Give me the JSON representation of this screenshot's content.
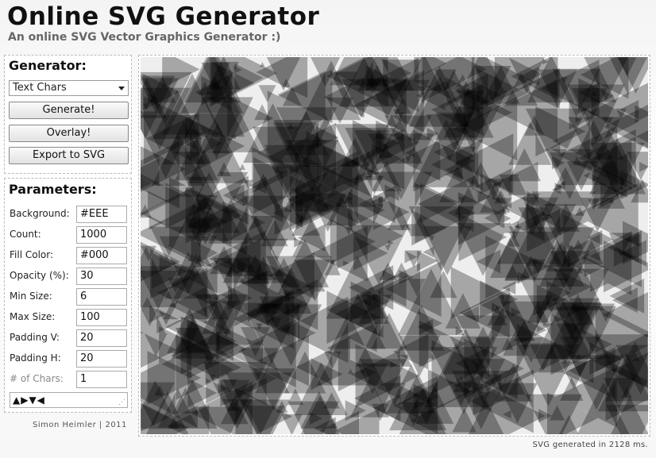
{
  "header": {
    "title": "Online SVG Generator",
    "subtitle": "An online SVG Vector Graphics Generator :)"
  },
  "generator": {
    "heading": "Generator:",
    "type_selected": "Text Chars",
    "generate_label": "Generate!",
    "overlay_label": "Overlay!",
    "export_label": "Export to SVG"
  },
  "parameters": {
    "heading": "Parameters:",
    "fields": [
      {
        "label": "Background:",
        "value": "#EEE",
        "enabled": true
      },
      {
        "label": "Count:",
        "value": "1000",
        "enabled": true
      },
      {
        "label": "Fill Color:",
        "value": "#000",
        "enabled": true
      },
      {
        "label": "Opacity (%):",
        "value": "30",
        "enabled": true
      },
      {
        "label": "Min Size:",
        "value": "6",
        "enabled": true
      },
      {
        "label": "Max Size:",
        "value": "100",
        "enabled": true
      },
      {
        "label": "Padding V:",
        "value": "20",
        "enabled": true
      },
      {
        "label": "Padding H:",
        "value": "20",
        "enabled": true
      },
      {
        "label": "# of Chars:",
        "value": "1",
        "enabled": false
      }
    ],
    "chars": "▲▶▼◀"
  },
  "footer": {
    "credit": "Simon Heimler | 2011",
    "status": "SVG generated in 2128 ms."
  },
  "canvas": {
    "background": "#EEEEEE",
    "fill": "#000000",
    "opacity": 0.3,
    "count": 1000,
    "min_size": 6,
    "max_size": 100,
    "padding_v": 20,
    "padding_h": 20
  }
}
